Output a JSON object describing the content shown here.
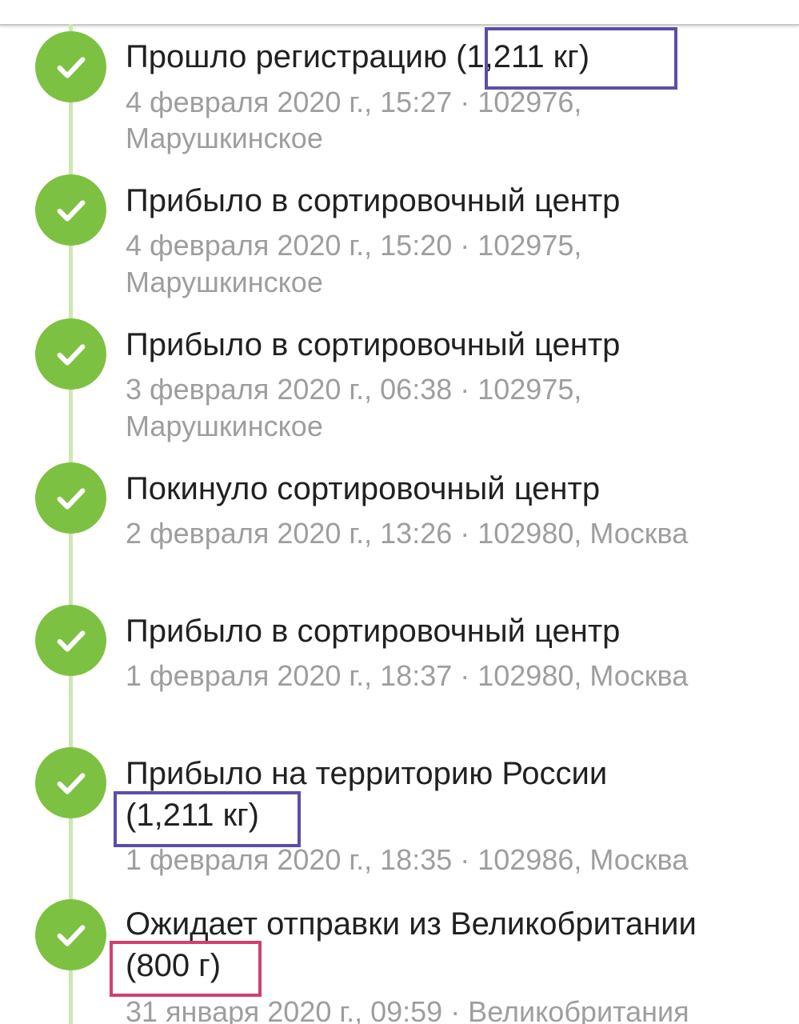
{
  "colors": {
    "check_green": "#7dc142",
    "timeline_line": "#cde7b3",
    "title_text": "#212121",
    "meta_text": "#9e9e9e",
    "highlight_purple": "#5b4ea8",
    "highlight_pink": "#d23f73"
  },
  "icons": {
    "status": "check-icon"
  },
  "events": [
    {
      "title": "Прошло регистрацию",
      "weight": "(1,211 кг)",
      "meta_line1": "4 февраля 2020 г., 15:27 · 102976,",
      "meta_line2": "Марушкинское"
    },
    {
      "title": "Прибыло в сортировочный центр",
      "meta_line1": "4 февраля 2020 г., 15:20 · 102975,",
      "meta_line2": "Марушкинское"
    },
    {
      "title": "Прибыло в сортировочный центр",
      "meta_line1": "3 февраля 2020 г., 06:38 · 102975,",
      "meta_line2": "Марушкинское"
    },
    {
      "title": "Покинуло сортировочный центр",
      "meta_line1": "2 февраля 2020 г., 13:26 · 102980, Москва"
    },
    {
      "title": "Прибыло в сортировочный центр",
      "meta_line1": "1 февраля 2020 г., 18:37 · 102980, Москва"
    },
    {
      "title": "Прибыло на территорию России",
      "weight": "(1,211 кг)",
      "meta_line1": "1 февраля 2020 г., 18:35 · 102986, Москва"
    },
    {
      "title": "Ожидает отправки из Великобритании",
      "weight": "(800 г)",
      "meta_line1": "31 января 2020 г., 09:59 · Великобритания"
    }
  ]
}
